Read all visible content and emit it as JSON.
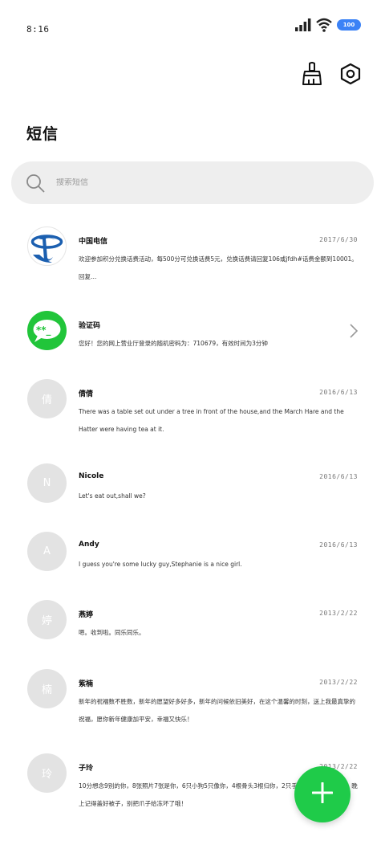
{
  "status_bar": {
    "time": "8:16",
    "battery": "100"
  },
  "page": {
    "title": "短信"
  },
  "search": {
    "placeholder": "搜索短信"
  },
  "colors": {
    "accent": "#1fcb49",
    "battery": "#3b82f6",
    "avatar_placeholder": "#e3e3e3",
    "search_bg": "#eeeeee"
  },
  "icons": {
    "clean": "broom-icon",
    "settings": "settings-hexagon-icon",
    "compose": "plus-icon"
  },
  "messages": [
    {
      "name": "中国电信",
      "date": "2017/6/30",
      "preview": "欢迎参加积分兑换话费活动，每500分可兑换话费5元，兑换话费请回复106或jfdh#话费金额到10001。回复…",
      "avatar": "china-telecom-logo"
    },
    {
      "name": "验证码",
      "date": "",
      "preview": "您好！您的网上营业厅登录的随机密码为：710679，有效时间为3分钟",
      "avatar": "sms-chat-icon"
    },
    {
      "name": "倩倩",
      "date": "2016/6/13",
      "preview": "There was a table set out under a tree in front of the house,and the March Hare and the Hatter were having tea at it.",
      "avatar": "倩"
    },
    {
      "name": "Nicole",
      "date": "2016/6/13",
      "preview": "Let's eat out,shall we?",
      "avatar": "N"
    },
    {
      "name": "Andy",
      "date": "2016/6/13",
      "preview": "I guess you're some lucky guy,Stephanie is a nice girl.",
      "avatar": "A"
    },
    {
      "name": "燕婷",
      "date": "2013/2/22",
      "preview": "嗯。收到啦。同乐同乐。",
      "avatar": "婷"
    },
    {
      "name": "紫楠",
      "date": "2013/2/22",
      "preview": "新年的祝福数不胜数，新年的愿望好多好多，新年的问候依旧美好，在这个温馨的时刻，送上我最真挚的祝福，愿你新年健康加平安，幸福又快乐！",
      "avatar": "楠"
    },
    {
      "name": "子玲",
      "date": "2013/2/22",
      "preview": "10分想念9别的你，8张照片7张是你，6只小狗5只像你，4根骨头3根归你，2只手想搂着你、天冷了，晚上记得盖好被子，别把爪子给冻坏了哦！",
      "avatar": "玲"
    }
  ]
}
